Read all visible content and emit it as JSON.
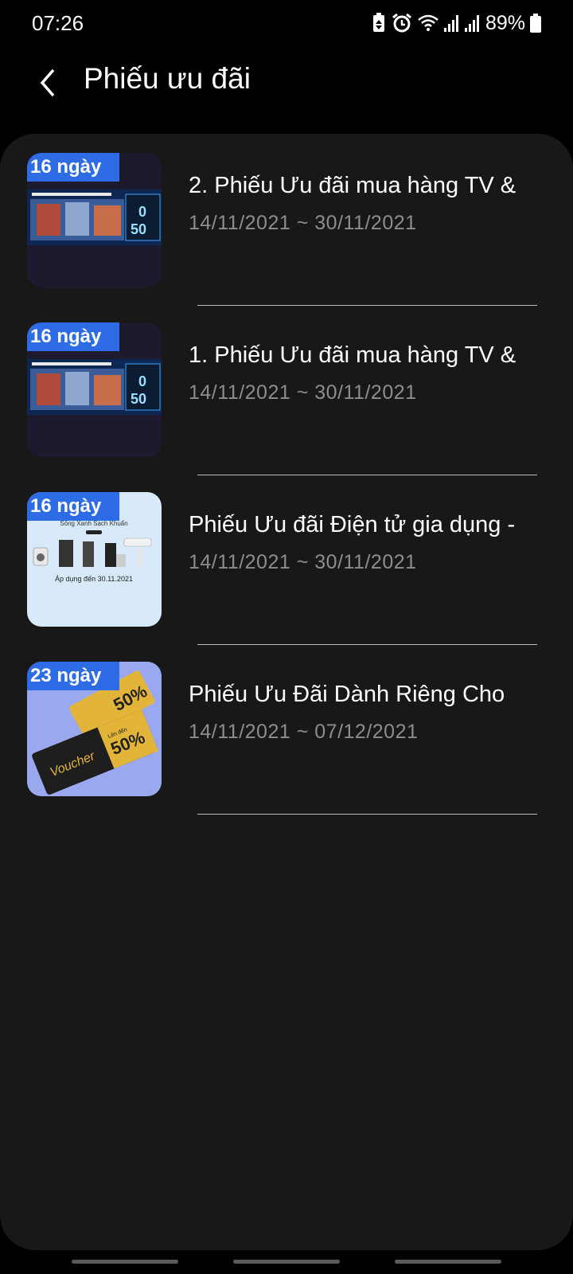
{
  "status_bar": {
    "time": "07:26",
    "battery": "89%"
  },
  "header": {
    "title": "Phiếu ưu đãi",
    "back_icon": "chevron-left-icon"
  },
  "coupons": [
    {
      "badge": "16 ngày",
      "title": "2. Phiếu Ưu đãi mua hàng TV &",
      "dates": "14/11/2021 ~ 30/11/2021",
      "thumb_kind": "tv-banner"
    },
    {
      "badge": "16 ngày",
      "title": "1. Phiếu Ưu đãi mua hàng TV &",
      "dates": "14/11/2021 ~ 30/11/2021",
      "thumb_kind": "tv-banner"
    },
    {
      "badge": "16 ngày",
      "title": "Phiếu Ưu đãi Điện tử gia dụng -",
      "dates": "14/11/2021 ~ 30/11/2021",
      "thumb_kind": "appliance-banner"
    },
    {
      "badge": "23 ngày",
      "title": "Phiếu Ưu Đãi Dành Riêng Cho",
      "dates": "14/11/2021 ~ 07/12/2021",
      "thumb_kind": "voucher-banner"
    }
  ],
  "thumb_text": {
    "appliance_heading": "Sống Xanh Sạch Khuẩn",
    "appliance_date": "Áp dụng đến 30.11.2021",
    "voucher_label": "Voucher",
    "voucher_discount": "50%",
    "voucher_prefix": "Lên đến"
  },
  "colors": {
    "background": "#000000",
    "panel": "#181818",
    "badge": "#2e6ce6",
    "date_text": "#8d8d8d"
  }
}
